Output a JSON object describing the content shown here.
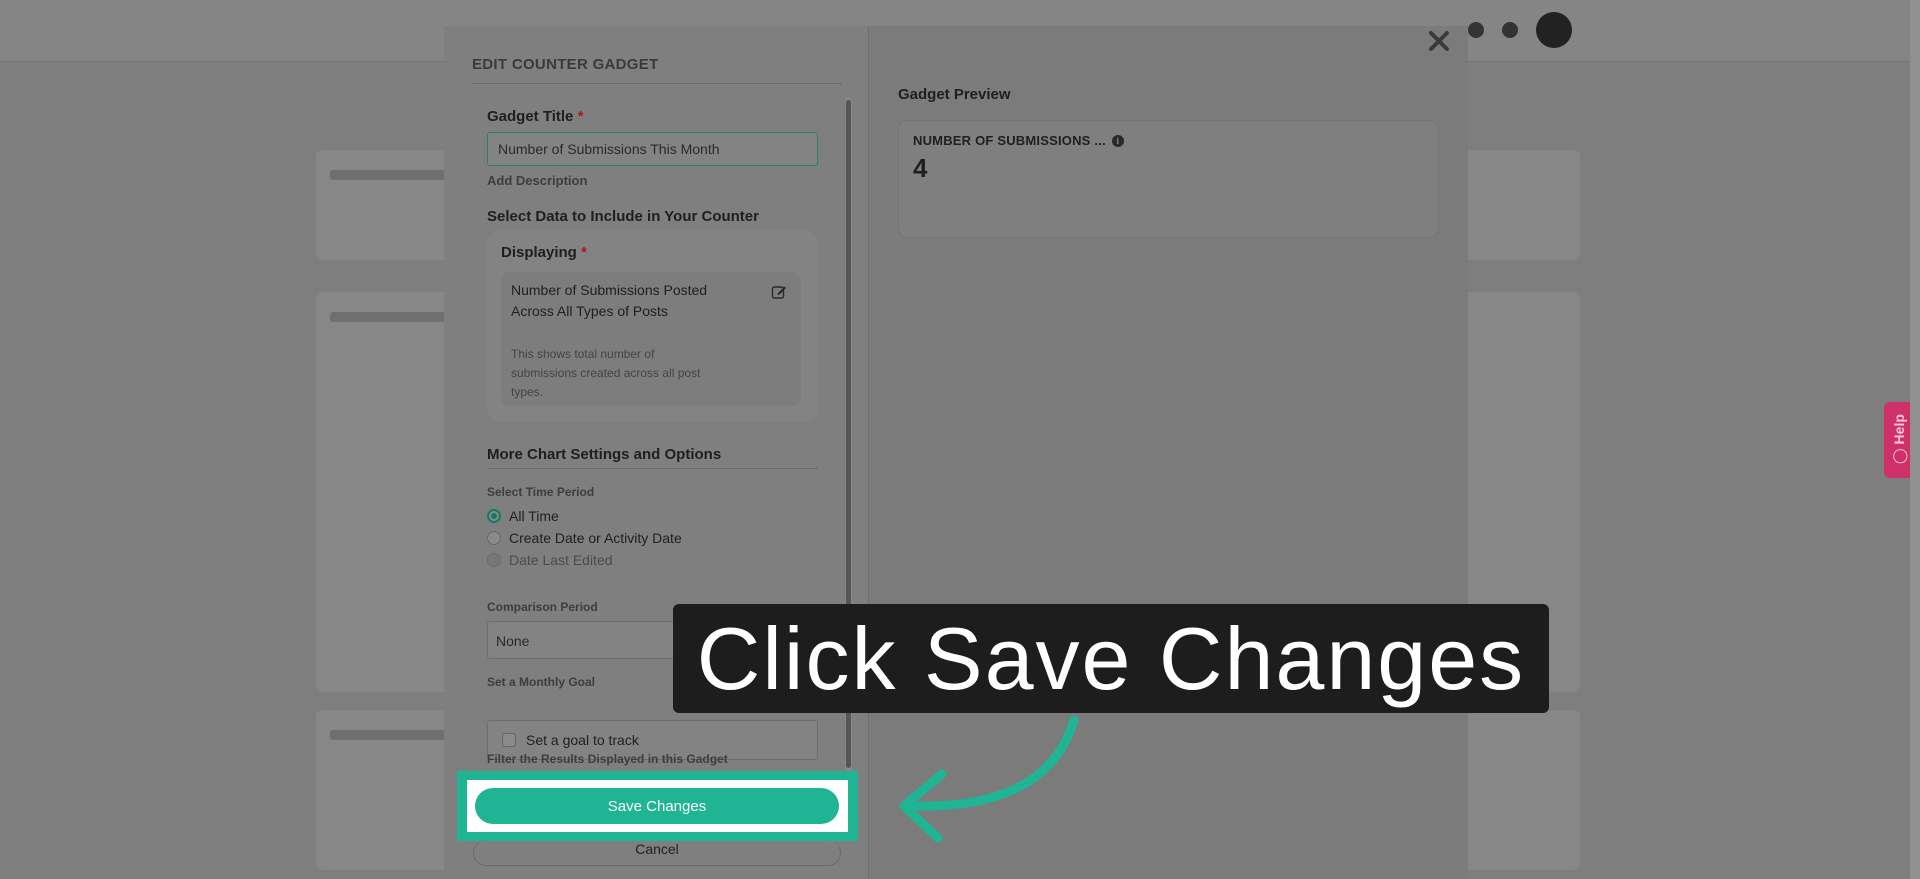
{
  "modal": {
    "heading": "EDIT COUNTER GADGET",
    "gadget_title_label": "Gadget Title",
    "required_mark": "*",
    "gadget_title_value": "Number of Submissions This Month",
    "add_description": "Add Description",
    "select_data_label": "Select Data to Include in Your Counter",
    "displaying_label": "Displaying",
    "displaying_name": "Number of Submissions Posted Across All Types of Posts",
    "displaying_desc": "This shows total number of submissions created across all post types.",
    "more_settings_label": "More Chart Settings and Options",
    "time_period_label": "Select Time Period",
    "time_options": [
      {
        "label": "All Time",
        "state": "checked"
      },
      {
        "label": "Create Date or Activity Date",
        "state": "unchecked"
      },
      {
        "label": "Date Last Edited",
        "state": "disabled"
      }
    ],
    "comparison_label": "Comparison Period",
    "comparison_value": "None",
    "monthly_goal_label": "Set a Monthly Goal",
    "goal_checkbox_label": "Set a goal to track",
    "filter_label": "Filter the Results Displayed in this Gadget",
    "save_label": "Save Changes",
    "cancel_label": "Cancel"
  },
  "preview": {
    "label": "Gadget Preview",
    "card_title": "NUMBER OF SUBMISSIONS ...",
    "card_value": "4"
  },
  "tooltip": {
    "text": "Click Save Changes"
  },
  "help": {
    "label": "Help"
  },
  "colors": {
    "accent": "#1fb594",
    "required": "#b01818",
    "help_tab": "#d0306a"
  }
}
